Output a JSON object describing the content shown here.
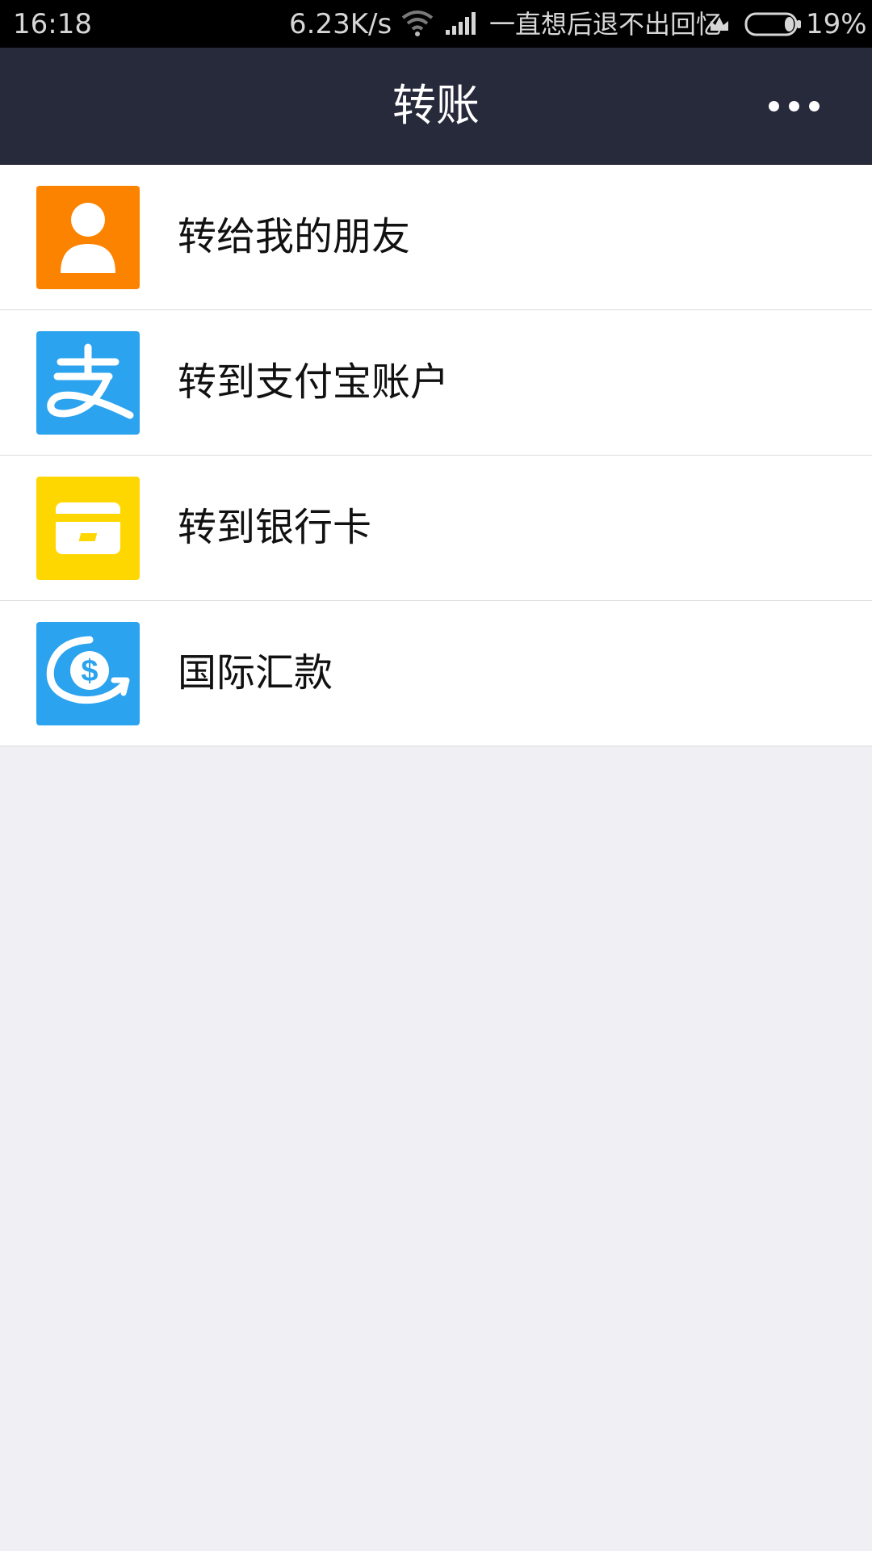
{
  "status_bar": {
    "time": "16:18",
    "network_speed": "6.23K/s",
    "carrier_text": "一直想后退不出回忆",
    "battery_percent": "19%",
    "battery_level": 0.19,
    "icons": [
      "wifi-icon",
      "signal-icon",
      "crown-icon",
      "battery-icon"
    ]
  },
  "nav": {
    "title": "转账",
    "more_icon": "more-dots-icon"
  },
  "menu": {
    "items": [
      {
        "label": "转给我的朋友",
        "icon": "person-icon",
        "icon_bg": "#fc8300"
      },
      {
        "label": "转到支付宝账户",
        "icon": "alipay-icon",
        "icon_bg": "#2ba3ee"
      },
      {
        "label": "转到银行卡",
        "icon": "bank-card-icon",
        "icon_bg": "#fed700"
      },
      {
        "label": "国际汇款",
        "icon": "international-remittance-icon",
        "icon_bg": "#2ba3ee"
      }
    ]
  },
  "colors": {
    "nav_bg": "#272a3b",
    "page_bg": "#efeff4",
    "status_bg": "#000000"
  }
}
